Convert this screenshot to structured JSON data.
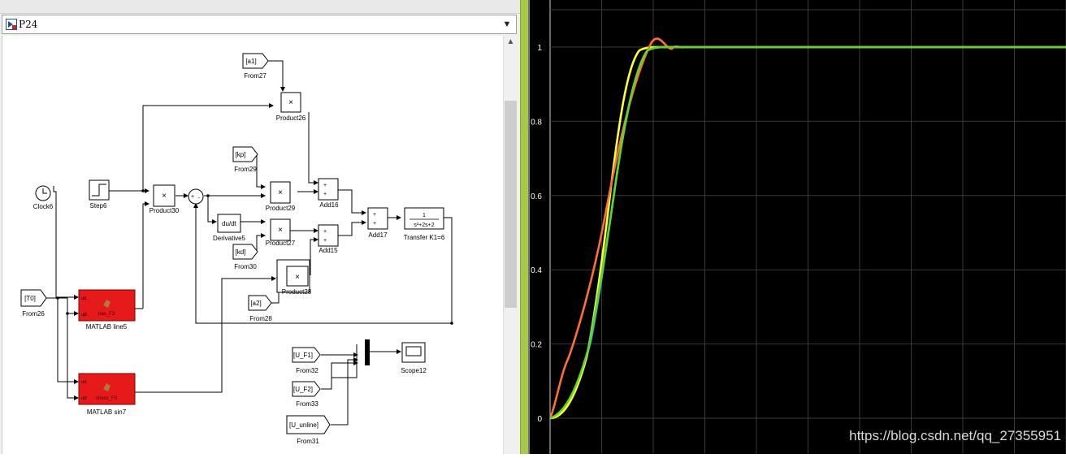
{
  "model": {
    "name": "P24"
  },
  "blocks": {
    "from27": {
      "tag": "[a1]",
      "label": "From27"
    },
    "product26": {
      "label": "Product26"
    },
    "from29": {
      "tag": "[kp]",
      "label": "From29"
    },
    "clock": {
      "label": "Clock6"
    },
    "step": {
      "label": "Step6"
    },
    "product30": {
      "label": "Product30"
    },
    "product29": {
      "label": "Product29"
    },
    "add16": {
      "label": "Add16"
    },
    "add17": {
      "label": "Add17"
    },
    "transfer": {
      "num": "1",
      "den": "s²+2s+2",
      "label": "Transfer K1=6"
    },
    "derivative": {
      "text": "du/dt",
      "label": "Derivative5"
    },
    "product27": {
      "label": "Product27"
    },
    "add15": {
      "label": "Add15"
    },
    "from30": {
      "tag": "[kd]",
      "label": "From30"
    },
    "product28": {
      "label": "Product28"
    },
    "from26": {
      "tag": "[T0]",
      "label": "From26"
    },
    "matlab5": {
      "label": "MATLAB line5",
      "inner": "tras_F3"
    },
    "from28": {
      "tag": "[a2]",
      "label": "From28"
    },
    "matlab7": {
      "label": "MATLAB sin7",
      "inner": "chess_F3"
    },
    "from32": {
      "tag": "[U_F1]",
      "label": "From32"
    },
    "from33": {
      "tag": "[U_F2]",
      "label": "From33"
    },
    "from31": {
      "tag": "[U_unline]",
      "label": "From31"
    },
    "scope": {
      "label": "Scope12"
    },
    "mult": "×",
    "plus": "+"
  },
  "scope_plot": {
    "yticks": [
      "1",
      "0.8",
      "0.6",
      "0.4",
      "0.2",
      "0"
    ],
    "colors": {
      "orange": "#ff7034",
      "yellow": "#ffff33",
      "cyan": "#22b5e8",
      "green": "#5fd42a",
      "grid": "#3a3a3a",
      "border": "#d0d0d0"
    }
  },
  "watermark": "https://blog.csdn.net/qq_27355951"
}
